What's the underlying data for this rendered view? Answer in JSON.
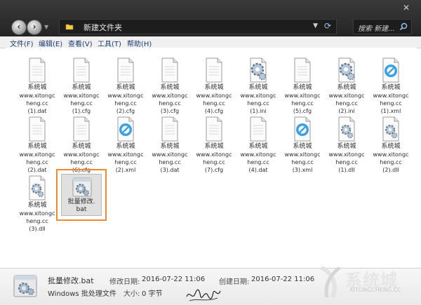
{
  "address": {
    "path": "新建文件夹"
  },
  "search": {
    "placeholder": "搜索 新建..."
  },
  "menu": [
    {
      "label": "文件(F)"
    },
    {
      "label": "编辑(E)"
    },
    {
      "label": "查看(V)"
    },
    {
      "label": "工具(T)"
    },
    {
      "label": "帮助(H)"
    }
  ],
  "files": [
    {
      "line1": "系统城",
      "line2": "www.xitongc",
      "line3": "heng.cc",
      "line4": "(1).dat",
      "icon": "document-icon"
    },
    {
      "line1": "系统城",
      "line2": "www.xitongc",
      "line3": "heng.cc",
      "line4": "(1).cfg",
      "icon": "document-icon"
    },
    {
      "line1": "系统城",
      "line2": "www.xitongc",
      "line3": "heng.cc",
      "line4": "(2).cfg",
      "icon": "document-icon"
    },
    {
      "line1": "系统城",
      "line2": "www.xitongc",
      "line3": "heng.cc",
      "line4": "(3).cfg",
      "icon": "document-icon"
    },
    {
      "line1": "系统城",
      "line2": "www.xitongc",
      "line3": "heng.cc",
      "line4": "(4).cfg",
      "icon": "document-icon"
    },
    {
      "line1": "系统城",
      "line2": "www.xitongc",
      "line3": "heng.cc",
      "line4": "(1).ini",
      "icon": "settings-file-icon"
    },
    {
      "line1": "系统城",
      "line2": "www.xitongc",
      "line3": "heng.cc",
      "line4": "(5).cfg",
      "icon": "document-icon"
    },
    {
      "line1": "系统城",
      "line2": "www.xitongc",
      "line3": "heng.cc",
      "line4": "(2).ini",
      "icon": "settings-file-icon"
    },
    {
      "line1": "系统城",
      "line2": "www.xitongc",
      "line3": "heng.cc",
      "line4": "(1).xml",
      "icon": "xml-file-icon"
    },
    {
      "line1": "系统城",
      "line2": "www.xitongc",
      "line3": "heng.cc",
      "line4": "(2).dat",
      "icon": "document-icon"
    },
    {
      "line1": "系统城",
      "line2": "www.xitongc",
      "line3": "heng.cc",
      "line4": "(6).cfg",
      "icon": "document-icon"
    },
    {
      "line1": "系统城",
      "line2": "www.xitongc",
      "line3": "heng.cc",
      "line4": "(2).xml",
      "icon": "xml-file-icon"
    },
    {
      "line1": "系统城",
      "line2": "www.xitongc",
      "line3": "heng.cc",
      "line4": "(3).dat",
      "icon": "document-icon"
    },
    {
      "line1": "系统城",
      "line2": "www.xitongc",
      "line3": "heng.cc",
      "line4": "(7).cfg",
      "icon": "document-icon"
    },
    {
      "line1": "系统城",
      "line2": "www.xitongc",
      "line3": "heng.cc",
      "line4": "(4).dat",
      "icon": "document-icon"
    },
    {
      "line1": "系统城",
      "line2": "www.xitongc",
      "line3": "heng.cc",
      "line4": "(3).xml",
      "icon": "xml-file-icon"
    },
    {
      "line1": "系统城",
      "line2": "www.xitongc",
      "line3": "heng.cc",
      "line4": "(1).dll",
      "icon": "dll-file-icon"
    },
    {
      "line1": "系统城",
      "line2": "www.xitongc",
      "line3": "heng.cc",
      "line4": "(2).dll",
      "icon": "dll-file-icon"
    },
    {
      "line1": "系统城",
      "line2": "www.xitongc",
      "line3": "heng.cc",
      "line4": "(3).dll",
      "icon": "dll-file-icon"
    }
  ],
  "selected_file": {
    "line1": "批量修改.",
    "line2": "bat",
    "icon": "batch-file-icon"
  },
  "details": {
    "name": "批量修改.bat",
    "type": "Windows 批处理文件",
    "modified_label": "修改日期:",
    "modified_value": "2016-07-22 11:06",
    "created_label": "创建日期:",
    "created_value": "2016-07-22 11:06",
    "size_label": "大小:",
    "size_value": "0 字节"
  },
  "watermark": {
    "text": "系统城",
    "sub": "XITONGCHENG.CC"
  },
  "colors": {
    "selection_border": "#f0892e",
    "menu_text": "#1b3c73",
    "titlebar": "#2b2b2b"
  }
}
